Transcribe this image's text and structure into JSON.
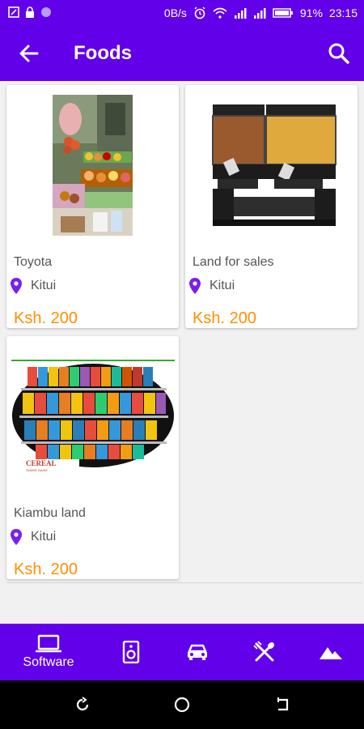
{
  "status_bar": {
    "data_rate": "0B/s",
    "battery": "91%",
    "time": "23:15"
  },
  "app_bar": {
    "title": "Foods"
  },
  "listings": [
    {
      "title": "Toyota",
      "location": "Kitui",
      "price": "Ksh. 200",
      "image": "market-stall-photo"
    },
    {
      "title": "Land for sales",
      "location": "Kitui",
      "price": "Ksh. 200",
      "image": "cereal-dispenser-photo"
    },
    {
      "title": "Kiambu land",
      "location": "Kitui",
      "price": "Ksh. 200",
      "image": "cereal-shelf-photo",
      "image_caption": "CEREAL"
    }
  ],
  "bottom_nav": {
    "items": [
      {
        "label": "Software",
        "icon": "laptop-icon",
        "active": true
      },
      {
        "label": "",
        "icon": "speaker-icon"
      },
      {
        "label": "",
        "icon": "car-icon"
      },
      {
        "label": "",
        "icon": "cutlery-icon"
      },
      {
        "label": "",
        "icon": "mountain-icon"
      }
    ]
  },
  "colors": {
    "primary": "#6200ea",
    "price": "#ff8f00",
    "location_pin": "#7c1fe6"
  }
}
